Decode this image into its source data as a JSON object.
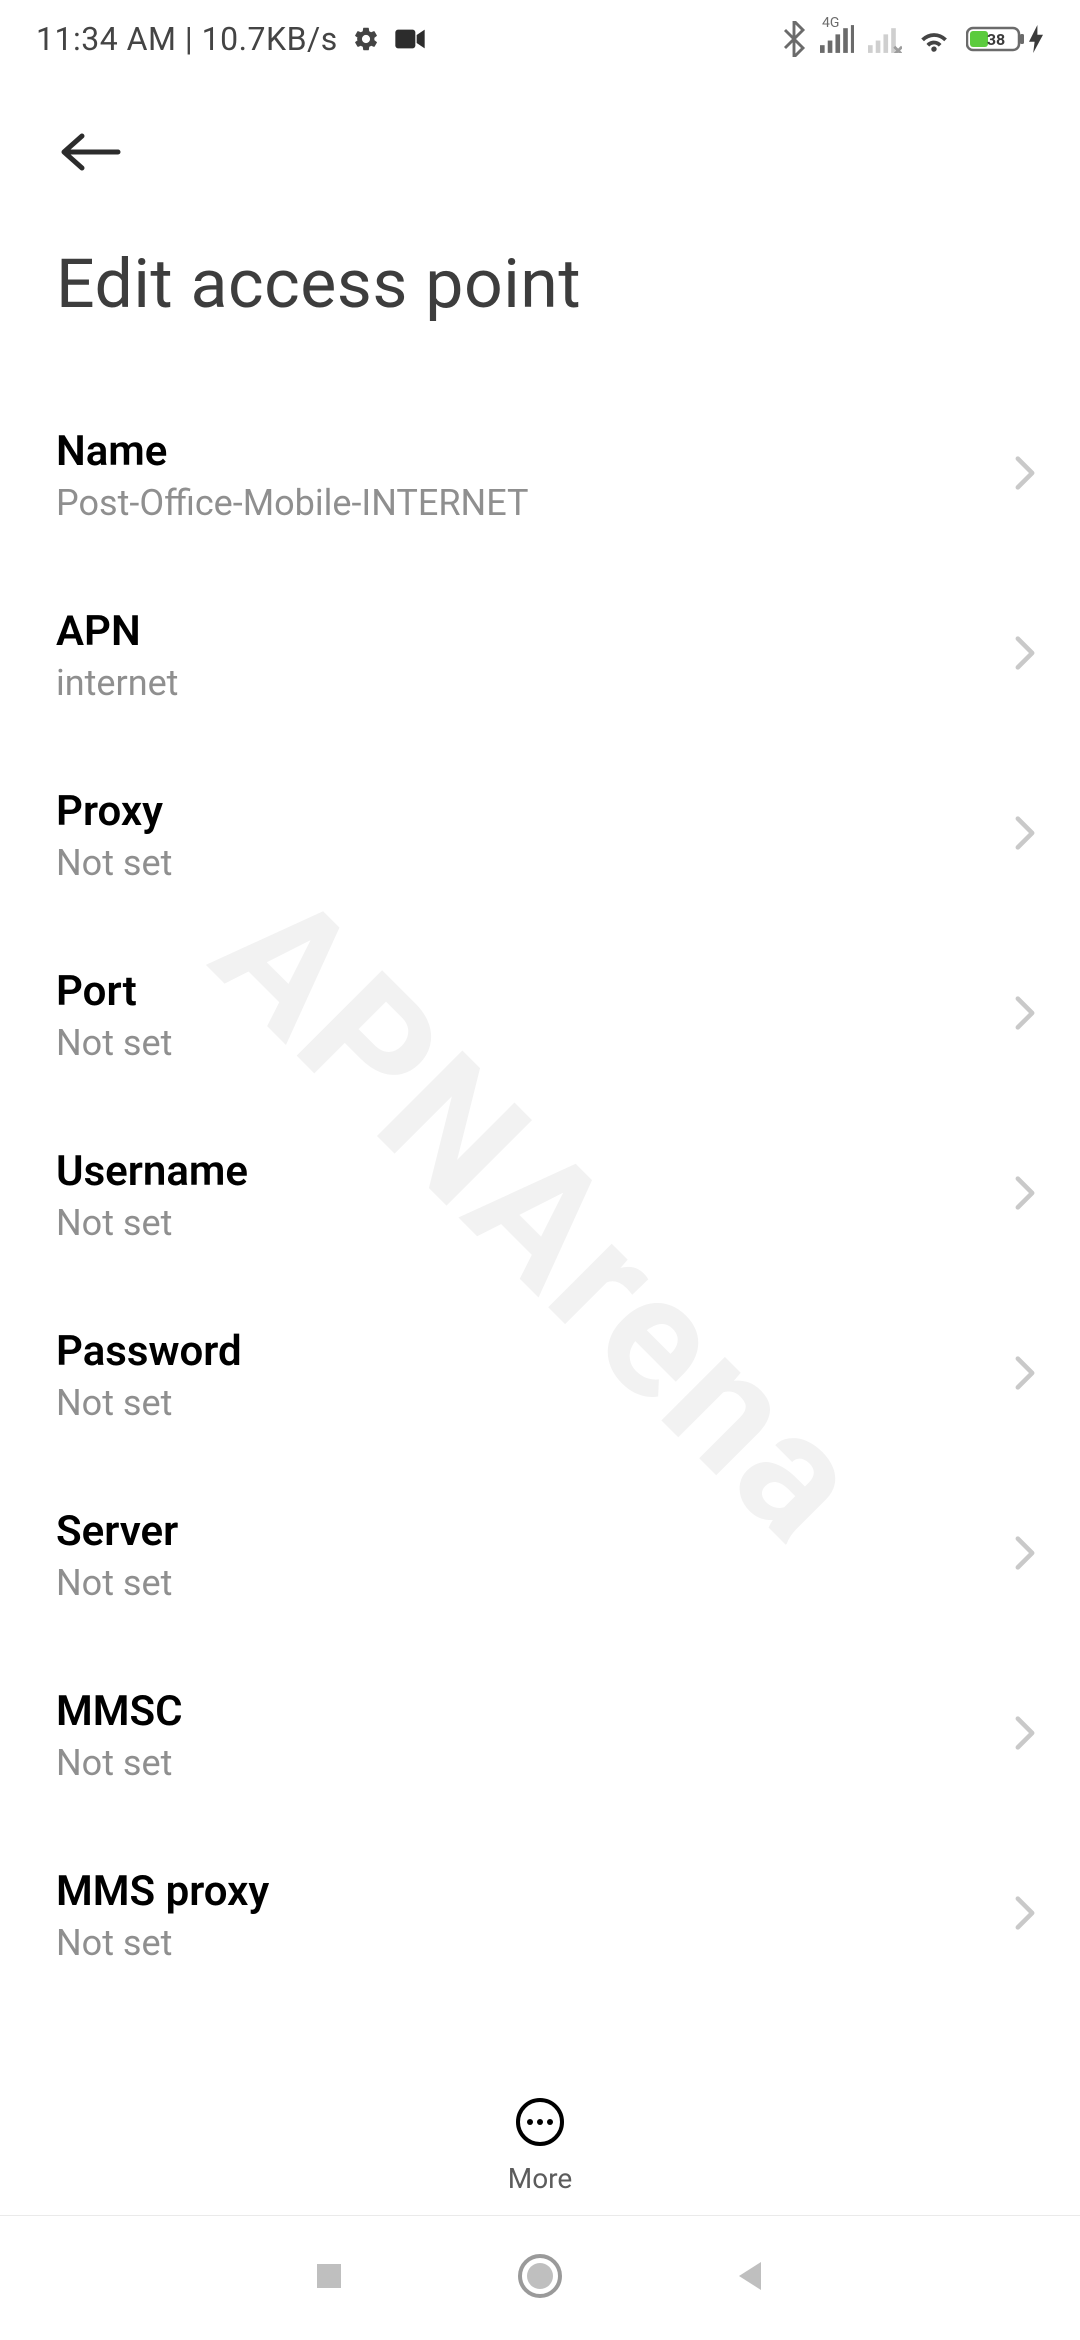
{
  "statusbar": {
    "time_speed": "11:34 AM | 10.7KB/s",
    "network_type": "4G",
    "battery_pct": "38"
  },
  "header": {
    "title": "Edit access point"
  },
  "fields": [
    {
      "label": "Name",
      "value": "Post-Office-Mobile-INTERNET"
    },
    {
      "label": "APN",
      "value": "internet"
    },
    {
      "label": "Proxy",
      "value": "Not set"
    },
    {
      "label": "Port",
      "value": "Not set"
    },
    {
      "label": "Username",
      "value": "Not set"
    },
    {
      "label": "Password",
      "value": "Not set"
    },
    {
      "label": "Server",
      "value": "Not set"
    },
    {
      "label": "MMSC",
      "value": "Not set"
    },
    {
      "label": "MMS proxy",
      "value": "Not set"
    }
  ],
  "footer": {
    "more_label": "More"
  },
  "watermark": "APNArena"
}
